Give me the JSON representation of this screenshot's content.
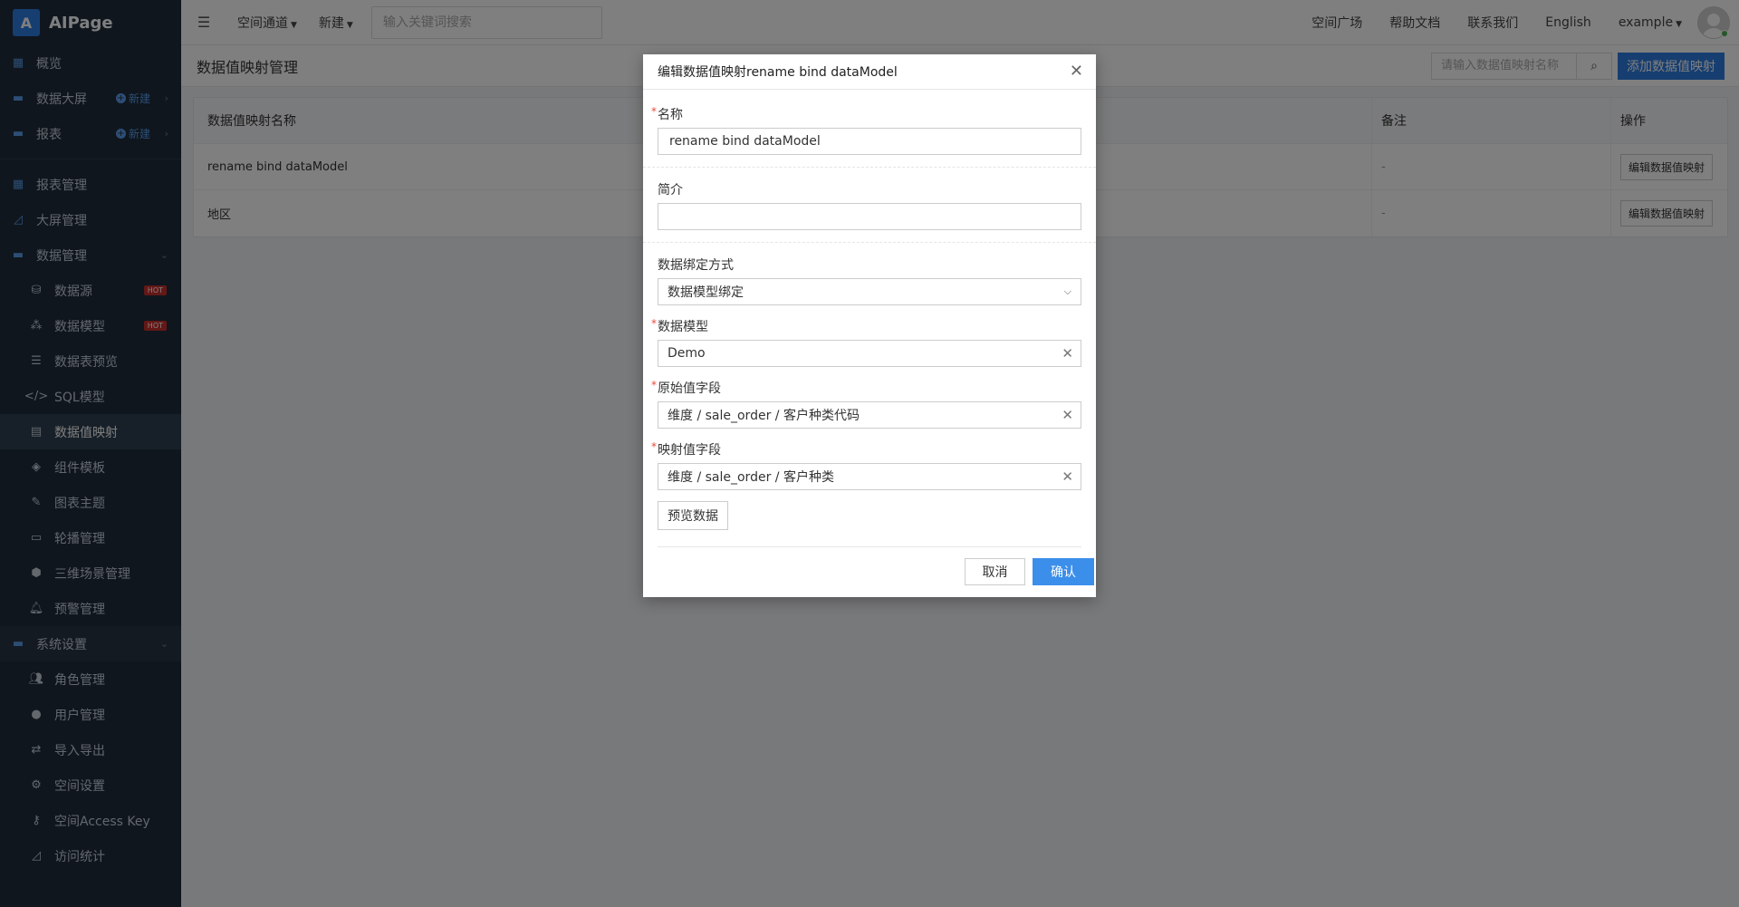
{
  "brand": {
    "logo": "A",
    "name": "AIPage"
  },
  "sidebar": {
    "group1": [
      {
        "label": "概览",
        "icon": "dashboard-icon"
      },
      {
        "label": "数据大屏",
        "icon": "folder-icon",
        "new": "新建"
      },
      {
        "label": "报表",
        "icon": "folder-icon",
        "new": "新建"
      }
    ],
    "group2": [
      {
        "label": "报表管理",
        "icon": "grid-icon"
      },
      {
        "label": "大屏管理",
        "icon": "area-chart-icon"
      },
      {
        "label": "数据管理",
        "icon": "folder-icon"
      }
    ],
    "data_sub": [
      {
        "label": "数据源",
        "icon": "database-icon",
        "badge": "HOT"
      },
      {
        "label": "数据模型",
        "icon": "cubes-icon",
        "badge": "HOT"
      },
      {
        "label": "数据表预览",
        "icon": "list-icon"
      },
      {
        "label": "SQL模型",
        "icon": "code-icon"
      },
      {
        "label": "数据值映射",
        "icon": "book-icon",
        "active": true
      },
      {
        "label": "组件模板",
        "icon": "layers-icon"
      },
      {
        "label": "图表主题",
        "icon": "magic-icon"
      },
      {
        "label": "轮播管理",
        "icon": "monitor-icon"
      },
      {
        "label": "三维场景管理",
        "icon": "cube-icon"
      },
      {
        "label": "预警管理",
        "icon": "bell-icon"
      }
    ],
    "system": {
      "label": "系统设置",
      "icon": "folder-icon"
    },
    "system_sub": [
      {
        "label": "角色管理",
        "icon": "users-icon"
      },
      {
        "label": "用户管理",
        "icon": "user-icon"
      },
      {
        "label": "导入导出",
        "icon": "exchange-icon"
      },
      {
        "label": "空间设置",
        "icon": "gear-icon"
      },
      {
        "label": "空间Access Key",
        "icon": "key-icon"
      },
      {
        "label": "访问统计",
        "icon": "line-chart-icon"
      }
    ]
  },
  "topbar": {
    "space_channel": "空间通道",
    "new": "新建",
    "search_placeholder": "输入关键词搜索",
    "square": "空间广场",
    "help": "帮助文档",
    "contact": "联系我们",
    "language": "English",
    "user": "example"
  },
  "page": {
    "title": "数据值映射管理",
    "search_placeholder": "请输入数据值映射名称",
    "add_button": "添加数据值映射",
    "columns": {
      "name": "数据值映射名称",
      "remark": "备注",
      "action": "操作"
    },
    "rows": [
      {
        "name": "rename bind dataModel",
        "remark": "-",
        "action": "编辑数据值映射"
      },
      {
        "name": "地区",
        "remark": "-",
        "action": "编辑数据值映射"
      }
    ]
  },
  "modal": {
    "title": "编辑数据值映射rename bind dataModel",
    "name_label": "名称",
    "name_value": "rename bind dataModel",
    "desc_label": "简介",
    "desc_value": "",
    "bind_label": "数据绑定方式",
    "bind_value": "数据模型绑定",
    "model_label": "数据模型",
    "model_value": "Demo",
    "orig_label": "原始值字段",
    "orig_value": "维度 / sale_order / 客户种类代码",
    "map_label": "映射值字段",
    "map_value": "维度 / sale_order / 客户种类",
    "preview_button": "预览数据",
    "cancel": "取消",
    "confirm": "确认",
    "required_mark": "*"
  }
}
